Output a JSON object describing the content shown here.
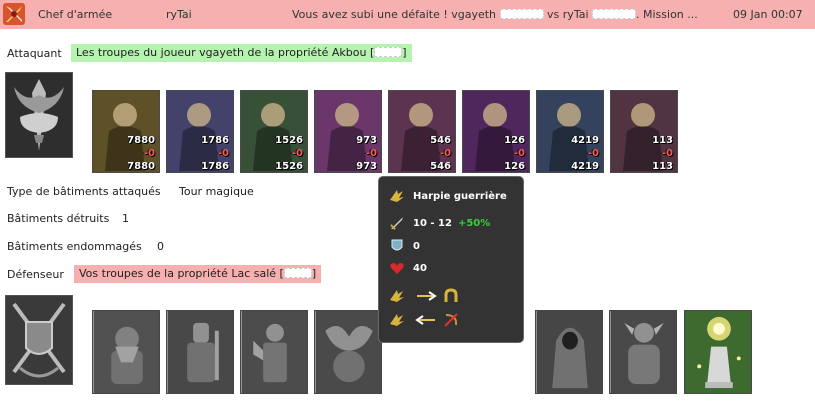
{
  "header": {
    "role": "Chef d'armée",
    "player": "ryTai",
    "message_prefix": "Vous avez subi une défaite ! vgayeth",
    "vs_text": "vs ryTai",
    "message_suffix": ". Mission ...",
    "date": "09 Jan 00:07"
  },
  "attacker": {
    "label": "Attaquant",
    "text": "Les troupes du joueur vgayeth de la propriété Akbou [",
    "text_end": "]",
    "units": [
      {
        "initial": "7880",
        "loss": "-0",
        "final": "7880",
        "color": "#6b5a2a"
      },
      {
        "initial": "1786",
        "loss": "-0",
        "final": "1786",
        "color": "#4a4a7a"
      },
      {
        "initial": "1526",
        "loss": "-0",
        "final": "1526",
        "color": "#3d5a3d"
      },
      {
        "initial": "973",
        "loss": "-0",
        "final": "973",
        "color": "#7a3d7a"
      },
      {
        "initial": "546",
        "loss": "-0",
        "final": "546",
        "color": "#6a3a5a"
      },
      {
        "initial": "126",
        "loss": "-0",
        "final": "126",
        "color": "#5a2a6a"
      },
      {
        "initial": "4219",
        "loss": "-0",
        "final": "4219",
        "color": "#3a4a6a"
      },
      {
        "initial": "113",
        "loss": "-0",
        "final": "113",
        "color": "#5a3a4a"
      }
    ]
  },
  "info": {
    "type_label": "Type de bâtiments attaqués",
    "type_value": "Tour magique",
    "destroyed_label": "Bâtiments détruits",
    "destroyed_value": "1",
    "damaged_label": "Bâtiments endommagés",
    "damaged_value": "0"
  },
  "defender": {
    "label": "Défenseur",
    "text": "Vos troupes de la propriété Lac salé [",
    "text_end": "]"
  },
  "tooltip": {
    "title": "Harpie guerrière",
    "damage": "10 - 12",
    "damage_bonus": "+50%",
    "armor": "0",
    "health": "40"
  },
  "icons": {
    "header": "defeat-swords-icon",
    "attack": "sword-icon",
    "armor": "shield-icon",
    "health": "heart-icon"
  }
}
